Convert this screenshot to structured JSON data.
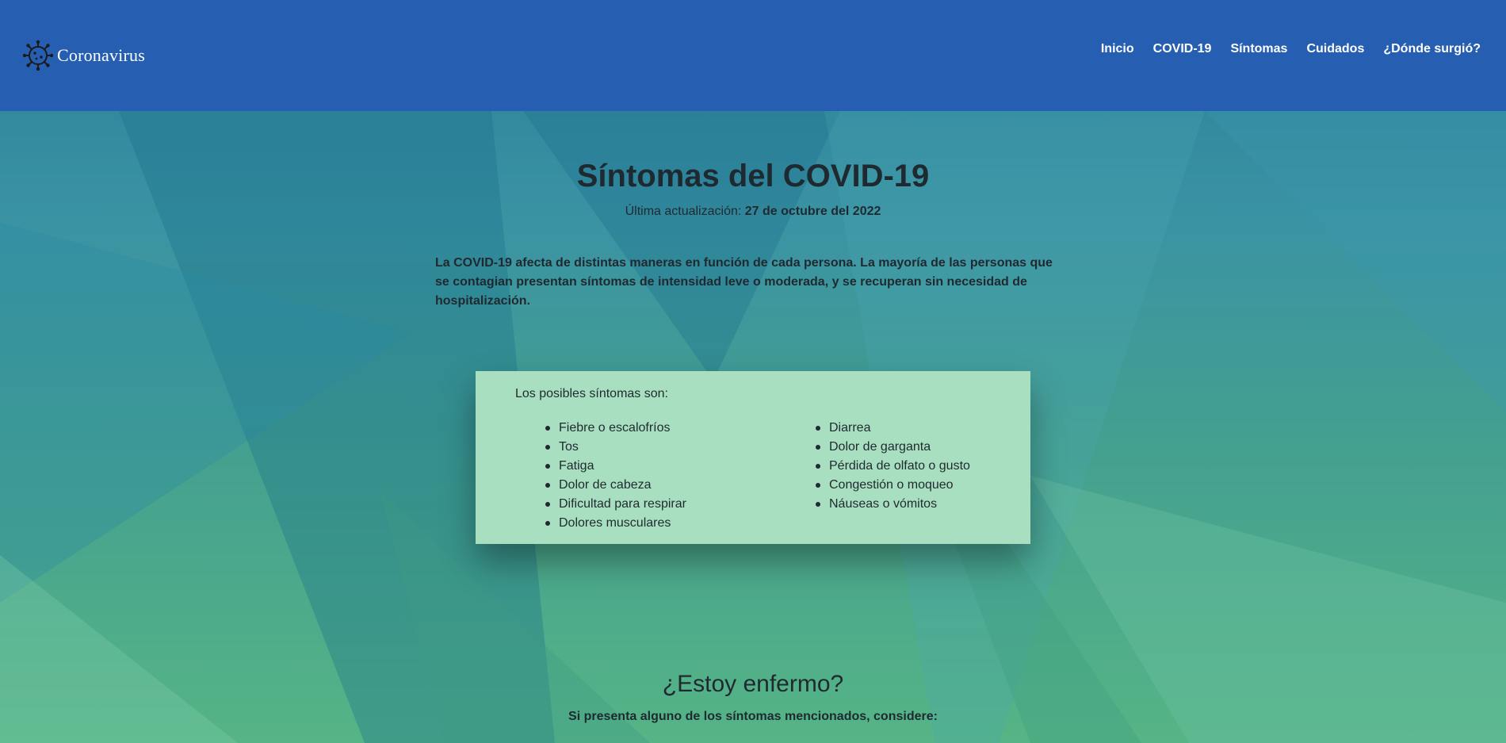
{
  "header": {
    "brand_name": "Coronavirus",
    "brand_icon": "virus-icon",
    "nav": [
      {
        "label": "Inicio"
      },
      {
        "label": "COVID-19"
      },
      {
        "label": "Síntomas"
      },
      {
        "label": "Cuidados"
      },
      {
        "label": "¿Dónde surgió?"
      }
    ]
  },
  "main": {
    "title": "Síntomas del COVID-19",
    "updated_label": "Última actualización:",
    "updated_date": "27 de octubre del 2022",
    "intro": "La COVID-19 afecta de distintas maneras en función de cada persona. La mayoría de las personas que se contagian presentan síntomas de intensidad leve o moderada, y se recuperan sin necesidad de hospitalización."
  },
  "symptoms": {
    "intro": "Los posibles síntomas son:",
    "column_1": [
      "Fiebre o escalofríos",
      "Tos",
      "Fatiga",
      "Dolor de cabeza",
      "Dificultad para respirar",
      "Dolores musculares"
    ],
    "column_2": [
      "Diarrea",
      "Dolor de garganta",
      "Pérdida de olfato o gusto",
      "Congestión o moqueo",
      "Náuseas o vómitos"
    ]
  },
  "sick_section": {
    "heading": "¿Estoy enfermo?",
    "subheading": "Si presenta alguno de los síntomas mencionados, considere:"
  },
  "colors": {
    "navbar": "#265eb2",
    "card": "#a8dfc0",
    "text": "#1f2a30"
  }
}
